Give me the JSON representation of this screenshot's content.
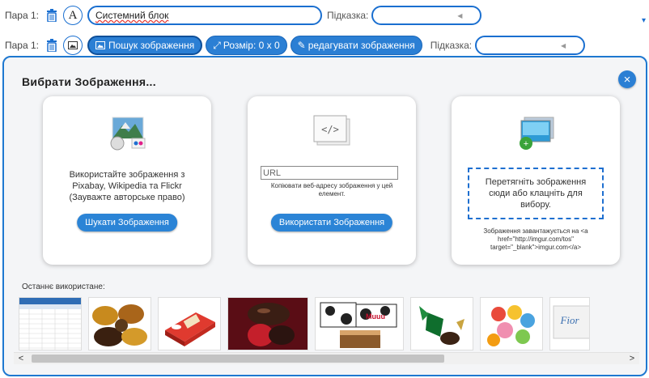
{
  "row1": {
    "label": "Пара 1:",
    "text_mode_icon": "letter-a-icon",
    "text_value": "Системний блок",
    "hint_label": "Підказка:",
    "hint_value": ""
  },
  "row2": {
    "label": "Пара 1:",
    "search_image_button": "Пошук зображення",
    "size_button": "Розмір: 0 х 0",
    "edit_image_button": "редагувати зображення",
    "hint_label": "Підказка:",
    "hint_value": ""
  },
  "modal": {
    "title": "Вибрати Зображення...",
    "close_label": "×",
    "search_card": {
      "text_line1": "Використайте зображення з",
      "text_line2": "Pixabay, Wikipedia та Flickr",
      "text_line3": "(Зауважте авторське право)",
      "button": "Шукати Зображення"
    },
    "url_card": {
      "input_placeholder": "URL",
      "note_line1": "Копіювати веб-адресу зображення у цей",
      "note_line2": "елемент.",
      "button": "Використати Зображення"
    },
    "upload_card": {
      "drop_text": "Перетягніть зображення сюди або клацніть для вибору.",
      "note_line1": "Зображення завантажується на <a",
      "note_line2": "href=\"http://imgur.com/tos\"",
      "note_line3": "target=\"_blank\">imgur.com</a>"
    },
    "recent_label": "Останнє використане:",
    "thumbnails": [
      "spreadsheet",
      "chocolate-candies",
      "candy-box",
      "chocolate-truffles",
      "milka-cow-candies",
      "green-wrapped-candy",
      "colorful-candies",
      "fiori-wrapper"
    ]
  },
  "colors": {
    "accent": "#2b7fd4",
    "modal_border": "#1e78d0",
    "modal_bg": "#f4f5f7"
  }
}
